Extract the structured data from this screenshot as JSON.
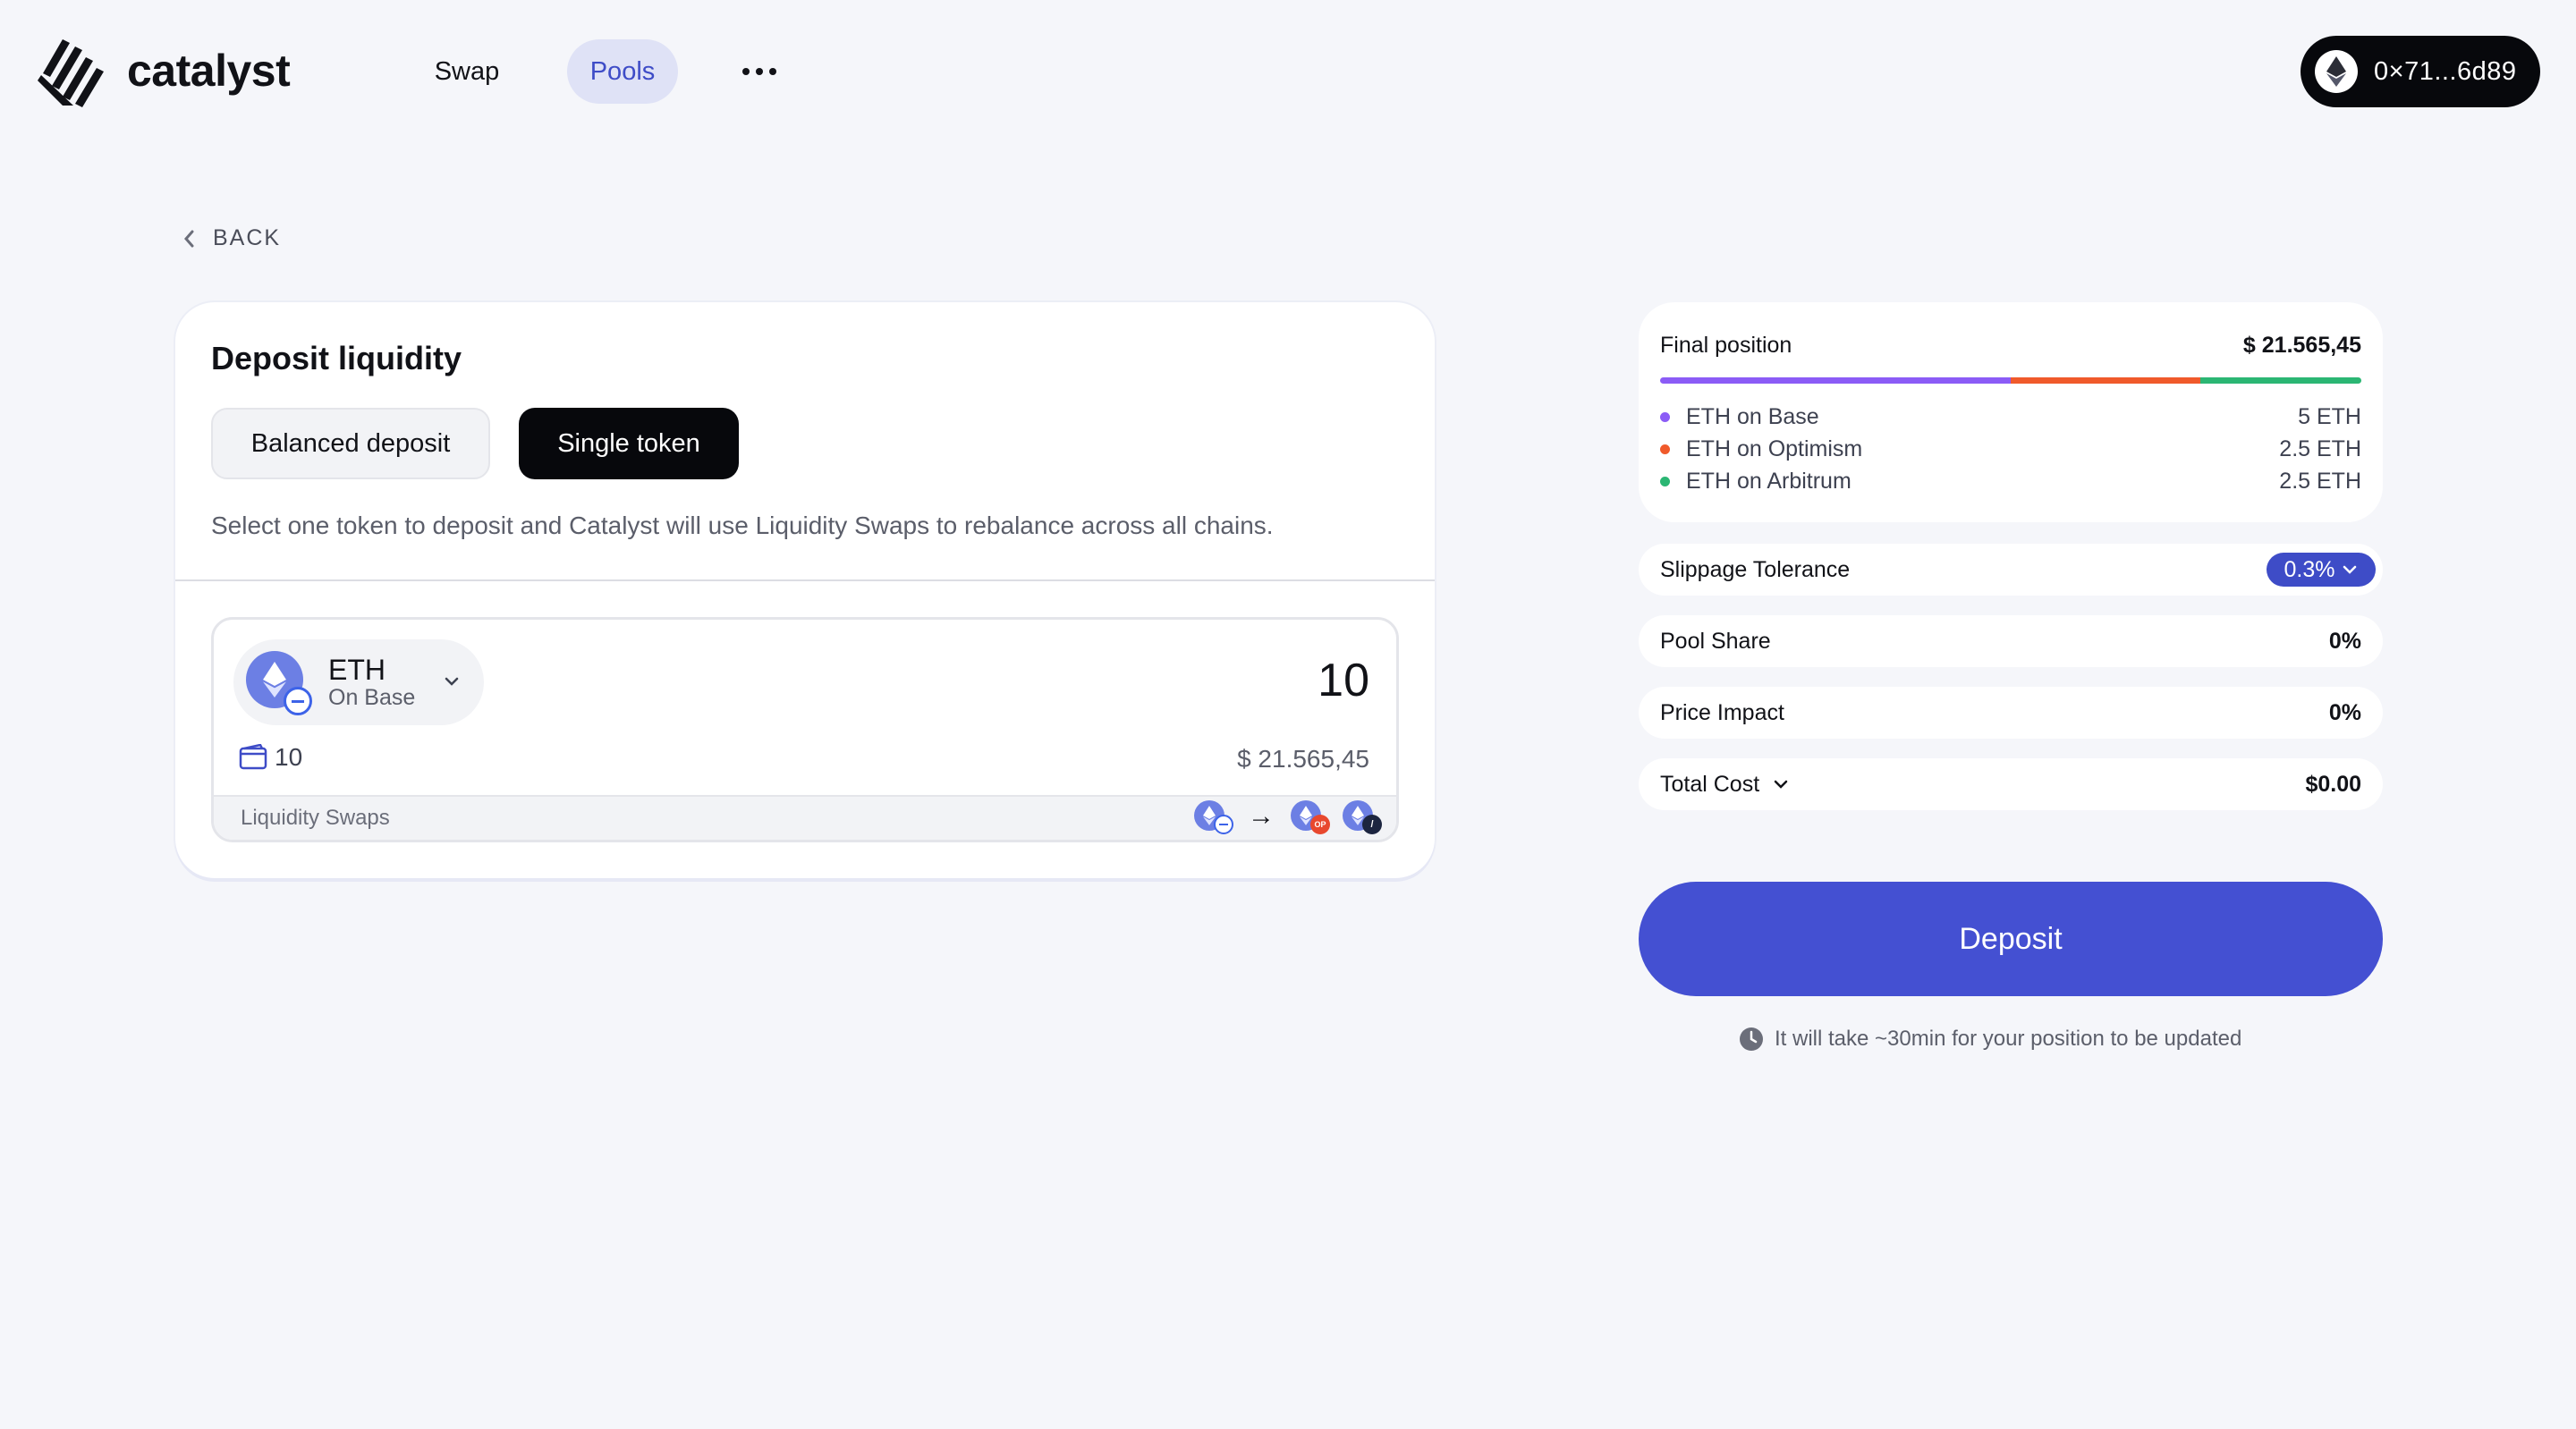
{
  "brand": {
    "name": "catalyst"
  },
  "nav": {
    "swap": "Swap",
    "pools": "Pools",
    "more": "more-options"
  },
  "wallet": {
    "address": "0×71...6d89",
    "icon": "ethereum-icon"
  },
  "back": {
    "label": "BACK"
  },
  "deposit_card": {
    "title": "Deposit liquidity",
    "tabs": [
      "Balanced deposit",
      "Single token"
    ],
    "active_tab": "Single token",
    "description": "Select one token to deposit and Catalyst will use Liquidity Swaps to rebalance across all chains.",
    "token": {
      "symbol": "ETH",
      "chain": "On Base"
    },
    "amount": "10",
    "balance": "10",
    "usd_value": "$ 21.565,45",
    "swaps_label": "Liquidity Swaps"
  },
  "final_position": {
    "label": "Final position",
    "value": "$ 21.565,45",
    "items": [
      {
        "label": "ETH on Base",
        "value": "5 ETH",
        "color": "#8b5cf6",
        "share": 0.5
      },
      {
        "label": "ETH on Optimism",
        "value": "2.5 ETH",
        "color": "#f05a2b",
        "share": 0.25
      },
      {
        "label": "ETH on Arbitrum",
        "value": "2.5 ETH",
        "color": "#2bb673",
        "share": 0.25
      }
    ]
  },
  "slippage": {
    "label": "Slippage Tolerance",
    "value": "0.3%"
  },
  "pool_share": {
    "label": "Pool Share",
    "value": "0%"
  },
  "price_impact": {
    "label": "Price Impact",
    "value": "0%"
  },
  "total_cost": {
    "label": "Total Cost",
    "value": "$0.00"
  },
  "deposit_button": "Deposit",
  "note": "It will take ~30min for your position to be updated",
  "colors": {
    "accent": "#4450d2",
    "pill_accent": "#3e4cc7",
    "background": "#f5f6fa"
  }
}
